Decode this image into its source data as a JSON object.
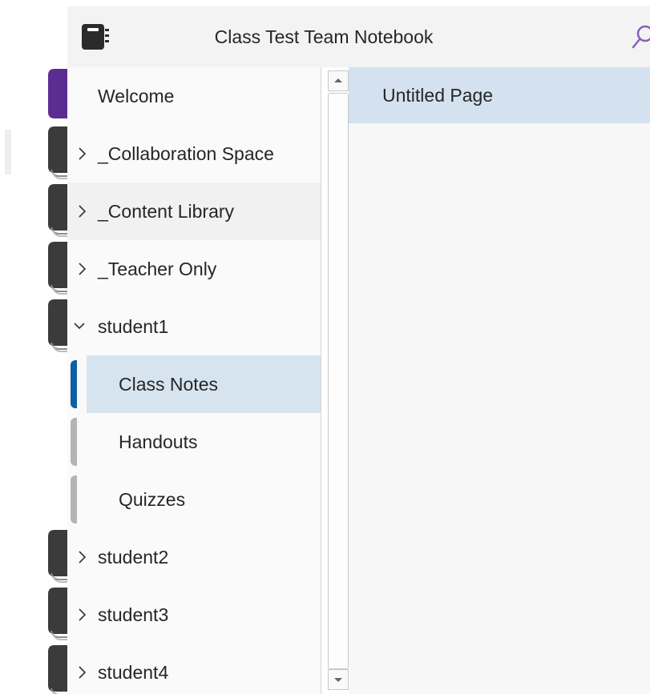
{
  "header": {
    "title": "Class Test Team Notebook",
    "notebook_icon": "notebook-icon",
    "search_icon": "search-icon",
    "search_color": "#8a5dc0"
  },
  "sections": [
    {
      "label": "Welcome",
      "expandable": false,
      "state": "none",
      "tab_color": "#5c2d91"
    },
    {
      "label": "_Collaboration Space",
      "expandable": true,
      "state": "collapsed",
      "tab_color": "#3b3b3b"
    },
    {
      "label": "_Content Library",
      "expandable": true,
      "state": "collapsed",
      "tab_color": "#3b3b3b"
    },
    {
      "label": "_Teacher Only",
      "expandable": true,
      "state": "collapsed",
      "tab_color": "#3b3b3b"
    },
    {
      "label": "student1",
      "expandable": true,
      "state": "expanded",
      "tab_color": "#3b3b3b"
    },
    {
      "label": "Class Notes",
      "expandable": false,
      "state": "selected",
      "tab_color": "#0f5fa5"
    },
    {
      "label": "Handouts",
      "expandable": false,
      "state": "none",
      "tab_color": "#b4b4b4"
    },
    {
      "label": "Quizzes",
      "expandable": false,
      "state": "none",
      "tab_color": "#b4b4b4"
    },
    {
      "label": "student2",
      "expandable": true,
      "state": "collapsed",
      "tab_color": "#3b3b3b"
    },
    {
      "label": "student3",
      "expandable": true,
      "state": "collapsed",
      "tab_color": "#3b3b3b"
    },
    {
      "label": "student4",
      "expandable": true,
      "state": "collapsed",
      "tab_color": "#3b3b3b"
    }
  ],
  "pages": [
    {
      "label": "Untitled Page",
      "selected": true
    }
  ],
  "colors": {
    "selected_bg": "#d6e4ef",
    "hover_bg": "#f1f1f1",
    "panel_bg": "#fafafa"
  }
}
